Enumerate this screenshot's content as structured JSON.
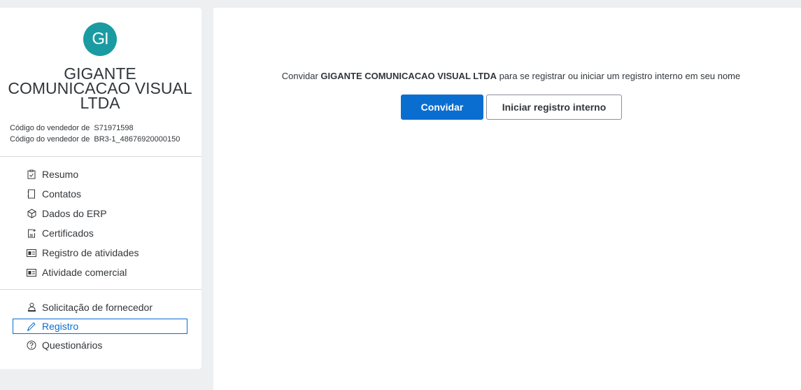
{
  "vendor": {
    "avatar_initials": "GI",
    "name_line1": "GIGANTE",
    "name_line2": "COMUNICACAO VISUAL",
    "name_line3": "LTDA",
    "codes": [
      {
        "label": "Código do vendedor de",
        "value": "S71971598"
      },
      {
        "label": "Código do vendedor de",
        "value": "BR3-1_48676920000150"
      }
    ]
  },
  "nav": {
    "group1": [
      {
        "label": "Resumo",
        "icon": "clipboard-check-icon"
      },
      {
        "label": "Contatos",
        "icon": "contacts-book-icon"
      },
      {
        "label": "Dados do ERP",
        "icon": "cube-icon"
      },
      {
        "label": "Certificados",
        "icon": "certificate-icon"
      },
      {
        "label": "Registro de atividades",
        "icon": "id-card-icon"
      },
      {
        "label": "Atividade comercial",
        "icon": "id-card-icon"
      }
    ],
    "group2": [
      {
        "label": "Solicitação de fornecedor",
        "icon": "supplier-person-icon"
      },
      {
        "label": "Registro",
        "icon": "pencil-icon",
        "active": true
      },
      {
        "label": "Questionários",
        "icon": "question-circle-icon"
      }
    ]
  },
  "main": {
    "invite_prefix": "Convidar ",
    "invite_company": "GIGANTE COMUNICACAO VISUAL LTDA",
    "invite_suffix": " para se registrar ou iniciar um registro interno em seu nome",
    "invite_button": "Convidar",
    "internal_button": "Iniciar registro interno"
  },
  "colors": {
    "avatar": "#1a9ba1",
    "primary": "#0a6ed1",
    "background": "#edeff0"
  }
}
